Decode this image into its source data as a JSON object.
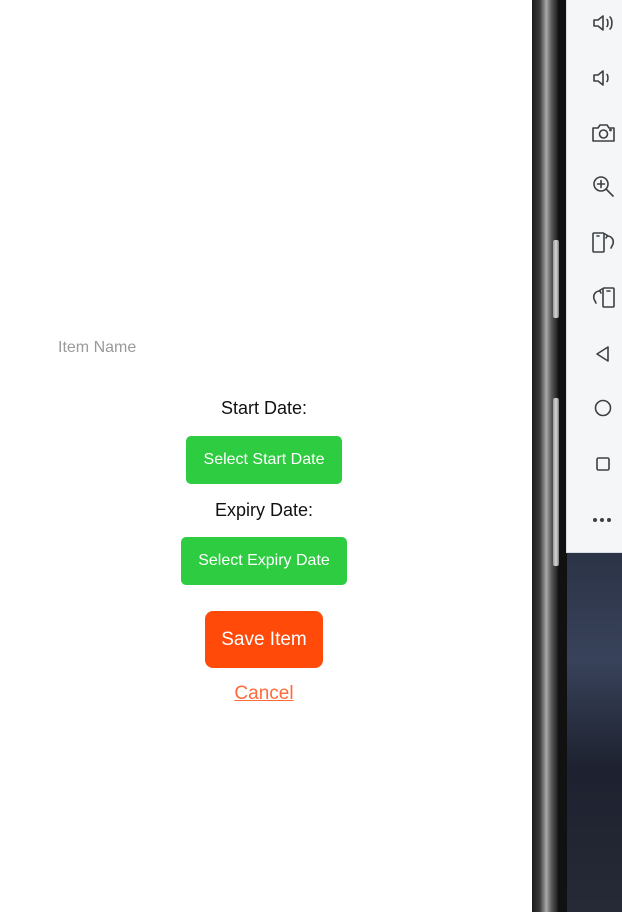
{
  "form": {
    "item_name_placeholder": "Item Name",
    "item_name_value": "",
    "start_date_label": "Start Date:",
    "select_start_date_label": "Select Start Date",
    "expiry_date_label": "Expiry Date:",
    "select_expiry_date_label": "Select Expiry Date",
    "save_label": "Save Item",
    "cancel_label": "Cancel"
  },
  "colors": {
    "date_button": "#2ecc40",
    "save_button": "#ff4a0a",
    "cancel_link": "#ff6a3d",
    "placeholder": "#9a9a9a"
  },
  "emulator_toolbar": {
    "buttons": [
      {
        "icon": "volume-up-icon",
        "action": "volume up"
      },
      {
        "icon": "volume-down-icon",
        "action": "volume down"
      },
      {
        "icon": "camera-icon",
        "action": "take screenshot"
      },
      {
        "icon": "zoom-in-icon",
        "action": "zoom"
      },
      {
        "icon": "rotate-right-icon",
        "action": "rotate right"
      },
      {
        "icon": "rotate-left-icon",
        "action": "rotate left"
      },
      {
        "icon": "back-icon",
        "action": "back"
      },
      {
        "icon": "home-icon",
        "action": "home"
      },
      {
        "icon": "overview-icon",
        "action": "overview"
      },
      {
        "icon": "more-icon",
        "action": "more"
      }
    ]
  }
}
